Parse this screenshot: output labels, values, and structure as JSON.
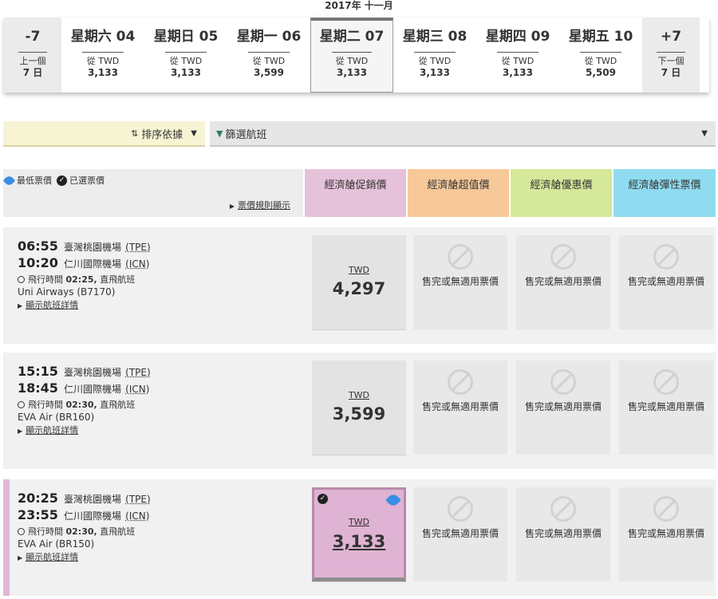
{
  "month_title": "2017年 十一月",
  "date_strip": {
    "prev": {
      "top": "-7",
      "line1": "上一個",
      "line2": "7 日"
    },
    "days": [
      {
        "weekday": "星期六",
        "day": "04",
        "from": "從 TWD",
        "price": "3,133"
      },
      {
        "weekday": "星期日",
        "day": "05",
        "from": "從 TWD",
        "price": "3,133"
      },
      {
        "weekday": "星期一",
        "day": "06",
        "from": "從 TWD",
        "price": "3,599"
      },
      {
        "weekday": "星期二",
        "day": "07",
        "from": "從 TWD",
        "price": "3,133"
      },
      {
        "weekday": "星期三",
        "day": "08",
        "from": "從 TWD",
        "price": "3,133"
      },
      {
        "weekday": "星期四",
        "day": "09",
        "from": "從 TWD",
        "price": "3,133"
      },
      {
        "weekday": "星期五",
        "day": "10",
        "from": "從 TWD",
        "price": "5,509"
      }
    ],
    "next": {
      "top": "+7",
      "line1": "下一個",
      "line2": "7 日"
    }
  },
  "sort": {
    "label": "排序依據"
  },
  "filter": {
    "label": "篩選航班"
  },
  "fare_header": {
    "legend_lowest": "最低票價",
    "legend_selected": "已選票價",
    "rules_link": "票價規則顯示",
    "columns": [
      "經濟艙促銷價",
      "經濟艙超值價",
      "經濟艙優惠價",
      "經濟艙彈性票價"
    ]
  },
  "unavailable_text": "售完或無適用票價",
  "flights": [
    {
      "dep_time": "06:55",
      "dep_airport": "臺灣桃園機場",
      "dep_code": "(TPE)",
      "arr_time": "10:20",
      "arr_airport": "仁川國際機場",
      "arr_code": "(ICN)",
      "duration_label": "飛行時間",
      "duration": "02:25,",
      "nonstop": "直飛航班",
      "carrier": "Uni Airways (B7170)",
      "details": "顯示航班詳情",
      "currency": "TWD",
      "price": "4,297"
    },
    {
      "dep_time": "15:15",
      "dep_airport": "臺灣桃園機場",
      "dep_code": "(TPE)",
      "arr_time": "18:45",
      "arr_airport": "仁川國際機場",
      "arr_code": "(ICN)",
      "duration_label": "飛行時間",
      "duration": "02:30,",
      "nonstop": "直飛航班",
      "carrier": "EVA Air (BR160)",
      "details": "顯示航班詳情",
      "currency": "TWD",
      "price": "3,599"
    },
    {
      "dep_time": "20:25",
      "dep_airport": "臺灣桃園機場",
      "dep_code": "(TPE)",
      "arr_time": "23:55",
      "arr_airport": "仁川國際機場",
      "arr_code": "(ICN)",
      "duration_label": "飛行時間",
      "duration": "02:30,",
      "nonstop": "直飛航班",
      "carrier": "EVA Air (BR150)",
      "details": "顯示航班詳情",
      "currency": "TWD",
      "price": "3,133"
    }
  ]
}
